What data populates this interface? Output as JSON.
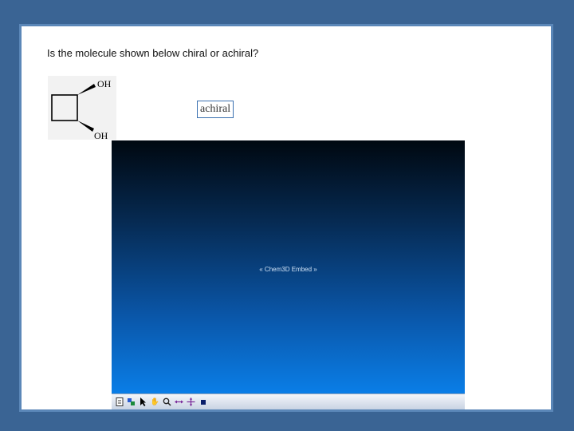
{
  "question": {
    "text": "Is the molecule shown below chiral or achiral?"
  },
  "molecule": {
    "top_label": "OH",
    "bottom_label": "OH"
  },
  "answer": {
    "value": "achiral"
  },
  "embed": {
    "label": "« Chem3D Embed »",
    "toolbar_icons": [
      "document-icon",
      "rotate-icon",
      "select-arrow-icon",
      "hand-icon",
      "zoom-icon",
      "translate-icon",
      "move-icon",
      "stop-icon"
    ]
  },
  "colors": {
    "background": "#3a6494",
    "slide_border": "#5b87b8",
    "answer_border": "#3a70b0"
  }
}
